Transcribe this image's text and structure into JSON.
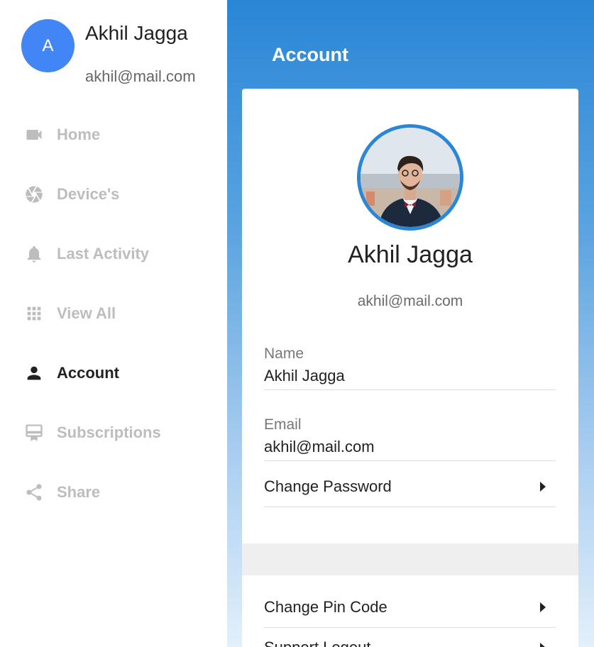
{
  "user": {
    "avatar_initial": "A",
    "name": "Akhil Jagga",
    "email": "akhil@mail.com"
  },
  "nav": [
    {
      "label": "Home",
      "icon": "video-camera-icon",
      "active": false
    },
    {
      "label": "Device's",
      "icon": "aperture-icon",
      "active": false
    },
    {
      "label": "Last Activity",
      "icon": "bell-icon",
      "active": false
    },
    {
      "label": "View All",
      "icon": "grid-icon",
      "active": false
    },
    {
      "label": "Account",
      "icon": "person-icon",
      "active": true
    },
    {
      "label": "Subscriptions",
      "icon": "card-icon",
      "active": false
    },
    {
      "label": "Share",
      "icon": "share-icon",
      "active": false
    }
  ],
  "page": {
    "title": "Account"
  },
  "card": {
    "name": "Akhil Jagga",
    "email": "akhil@mail.com",
    "fields": [
      {
        "label": "Name",
        "value": "Akhil Jagga"
      },
      {
        "label": "Email",
        "value": "akhil@mail.com"
      }
    ],
    "rows": [
      {
        "label": "Change Password"
      },
      {
        "label": "Change Pin Code"
      },
      {
        "label": "Support Logout"
      }
    ]
  },
  "colors": {
    "accent": "#2a86d6",
    "avatar": "#4285f4"
  }
}
